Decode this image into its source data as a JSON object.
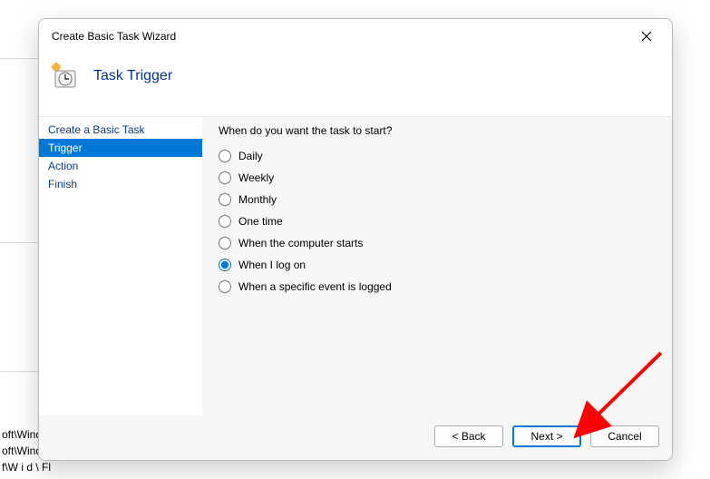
{
  "background": {
    "paths": [
      "oft\\Wind",
      "oft\\Windows\\U...",
      "  f\\W i  d    \\ Fl"
    ]
  },
  "dialog": {
    "title": "Create Basic Task Wizard",
    "header_title": "Task Trigger",
    "sidebar": {
      "items": [
        {
          "label": "Create a Basic Task",
          "active": false
        },
        {
          "label": "Trigger",
          "active": true
        },
        {
          "label": "Action",
          "active": false
        },
        {
          "label": "Finish",
          "active": false
        }
      ]
    },
    "content": {
      "prompt": "When do you want the task to start?",
      "options": [
        {
          "label": "Daily",
          "selected": false
        },
        {
          "label": "Weekly",
          "selected": false
        },
        {
          "label": "Monthly",
          "selected": false
        },
        {
          "label": "One time",
          "selected": false
        },
        {
          "label": "When the computer starts",
          "selected": false
        },
        {
          "label": "When I log on",
          "selected": true
        },
        {
          "label": "When a specific event is logged",
          "selected": false
        }
      ]
    },
    "footer": {
      "back": "< Back",
      "next": "Next >",
      "cancel": "Cancel"
    }
  }
}
